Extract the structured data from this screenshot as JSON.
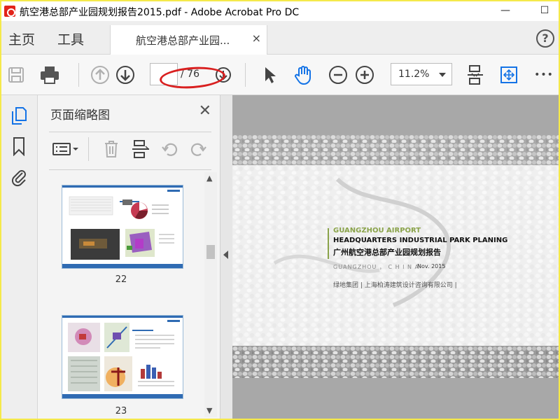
{
  "window": {
    "title": "航空港总部产业园规划报告2015.pdf - Adobe Acrobat Pro DC",
    "minimize": "—",
    "maximize": "☐"
  },
  "nav": {
    "home": "主页",
    "tools": "工具",
    "doc_tab": "航空港总部产业园...",
    "doc_tab_close": "×",
    "help": "?"
  },
  "toolbar": {
    "page_current": "",
    "page_total": "/ 76",
    "zoom": "11.2%",
    "more": "•••"
  },
  "panel": {
    "title": "页面缩略图",
    "close": "✕",
    "thumbnails": [
      {
        "page": "22"
      },
      {
        "page": "23"
      }
    ]
  },
  "document": {
    "cover": {
      "line1": "GUANGZHOU AIRPORT",
      "line2": "HEADQUARTERS INDUSTRIAL PARK PLANING",
      "line3": "广州航空港总部产业园规划报告",
      "line4_city": "GUANGZHOU ，  C H I N A",
      "line4_date": "Nov. 2015",
      "line5": "绿地集团 |   上海柏涛建筑设计咨询有限公司 |"
    }
  },
  "colors": {
    "accent_green": "#8aa34a",
    "annotation_red": "#d92020",
    "thumb_blue": "#2f6bb3",
    "toolbar_blue": "#1473e6"
  }
}
